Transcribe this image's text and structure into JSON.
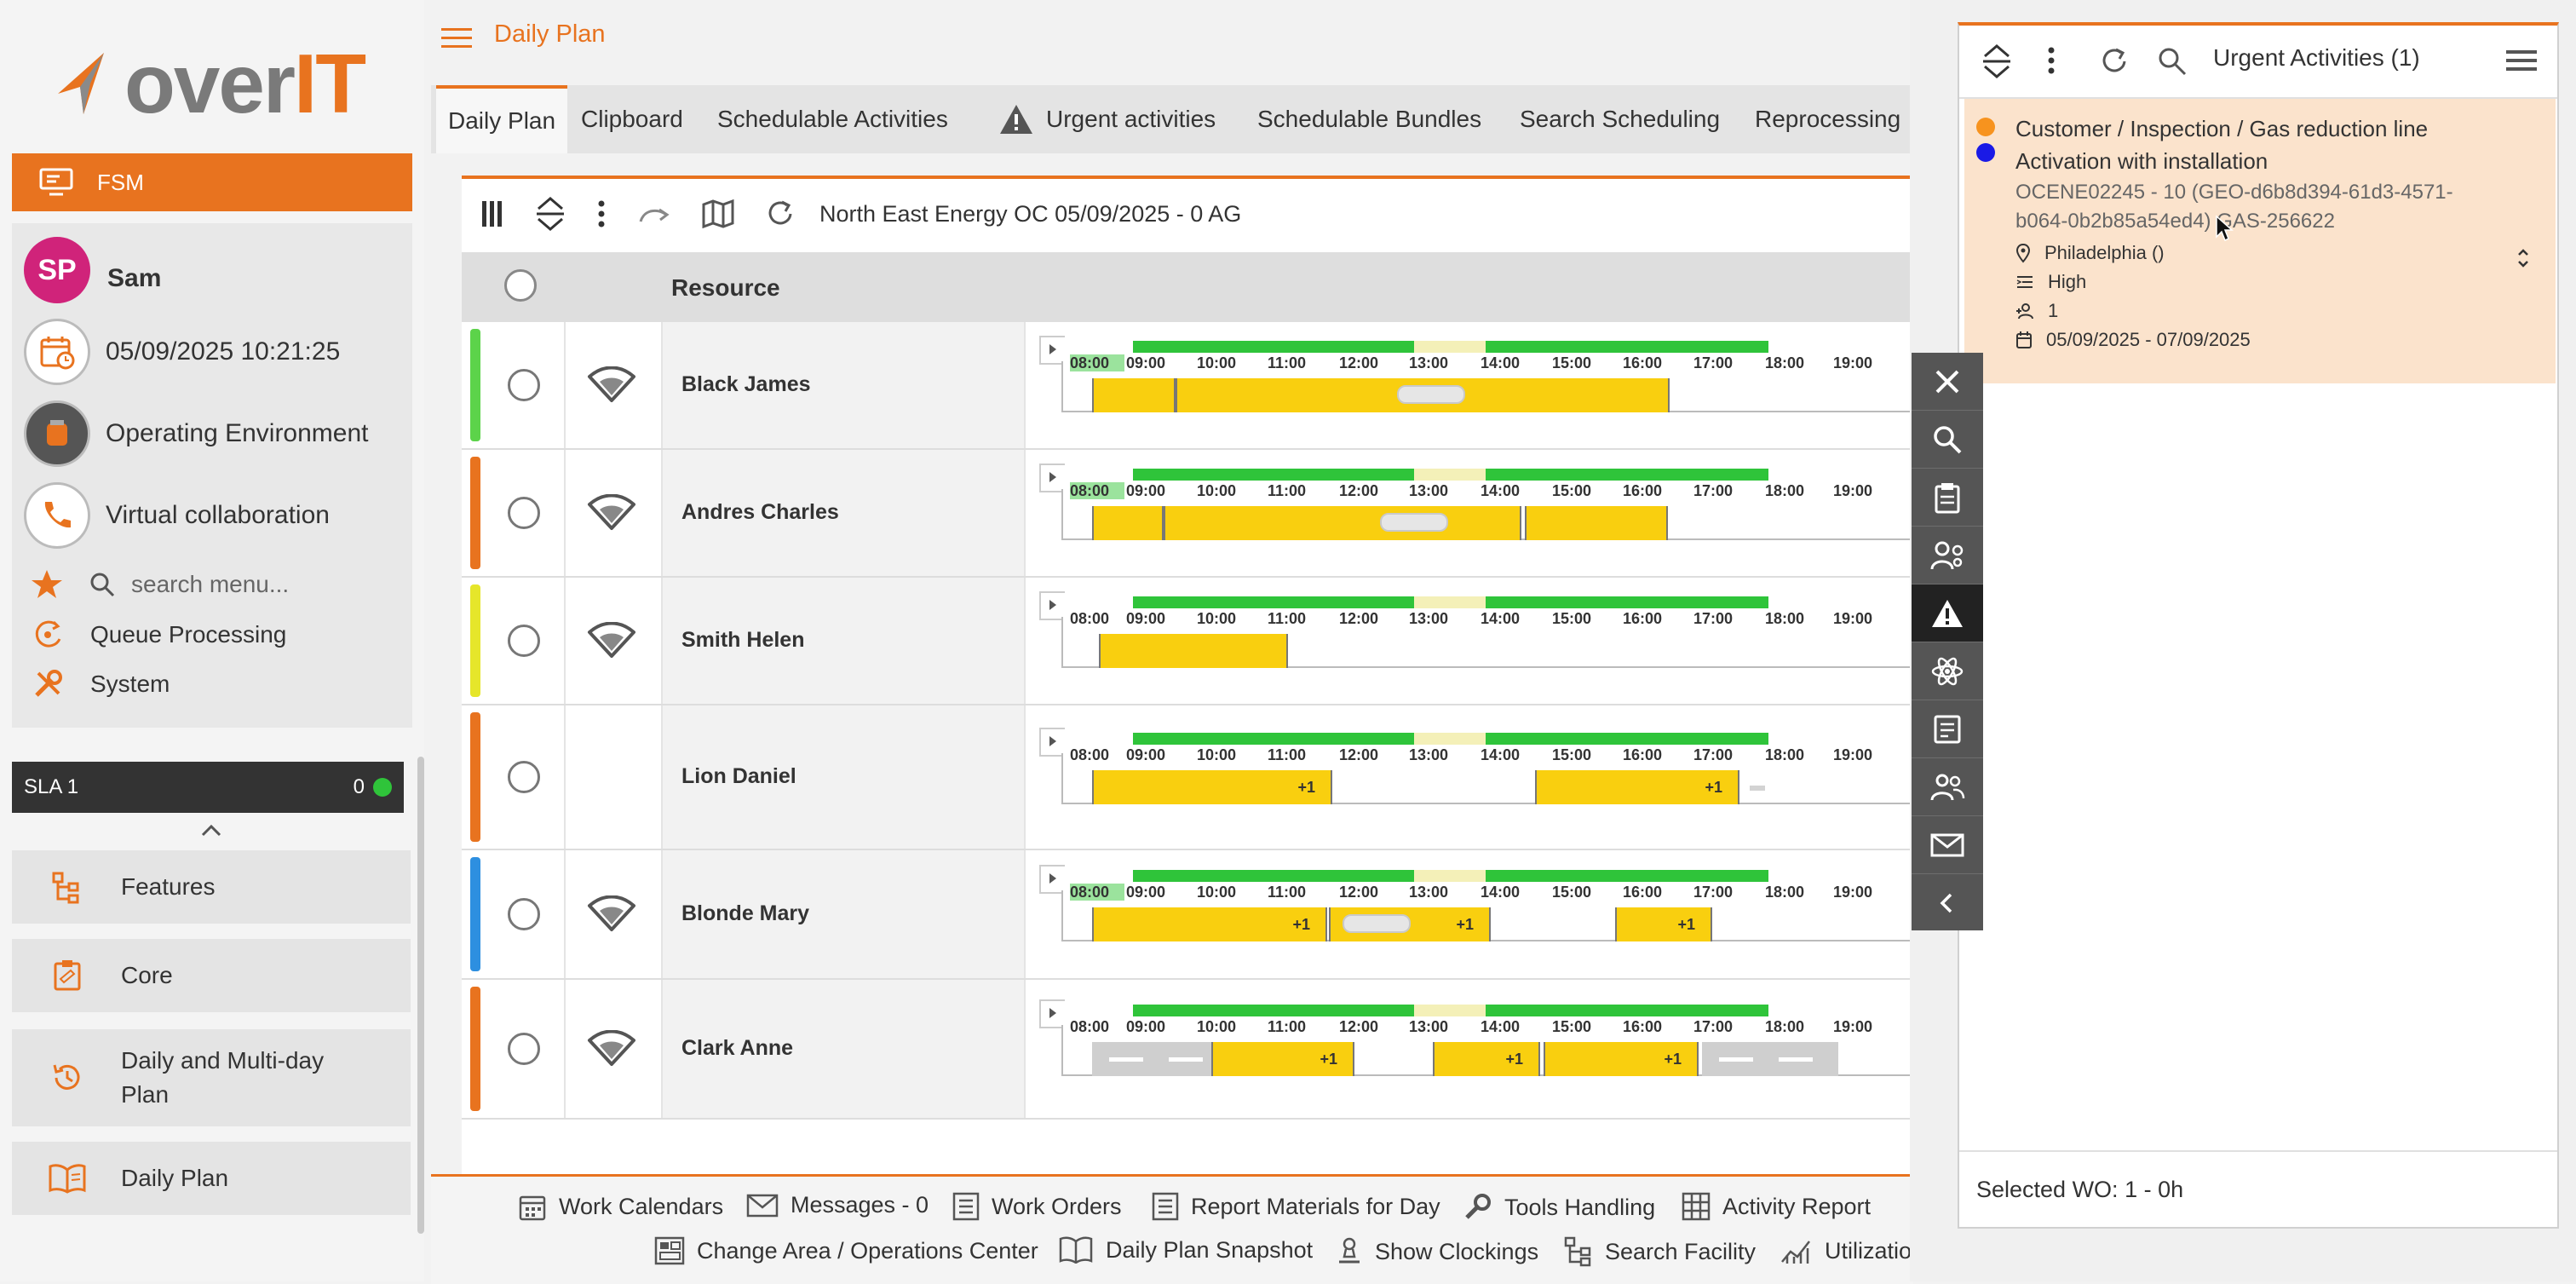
{
  "app": {
    "logo_text_a": "over",
    "logo_text_b": "IT",
    "module_label": "FSM",
    "page_title": "Daily Plan",
    "brand_color": "#e8731f"
  },
  "user_panel": {
    "avatar_initials": "SP",
    "user_name": "Sam",
    "datetime": "05/09/2025 10:21:25",
    "operating_env": "Operating Environment",
    "virtual_collab": "Virtual collaboration",
    "search_placeholder": "search menu...",
    "queue": "Queue Processing",
    "system": "System"
  },
  "sla": {
    "label": "SLA 1",
    "count": "0",
    "status_color": "#2fc43a"
  },
  "menu_tiles": [
    {
      "label": "Features",
      "icon": "features-icon"
    },
    {
      "label": "Core",
      "icon": "core-icon"
    },
    {
      "label": "Daily and Multi-day Plan",
      "label_line1": "Daily and Multi-day",
      "label_line2": "Plan",
      "icon": "history-icon"
    },
    {
      "label": "Daily Plan",
      "icon": "book-icon"
    }
  ],
  "tabs": [
    {
      "label": "Daily Plan",
      "active": true
    },
    {
      "label": "Clipboard"
    },
    {
      "label": "Schedulable Activities"
    },
    {
      "label": "Urgent activities",
      "icon": "warning-icon"
    },
    {
      "label": "Schedulable Bundles"
    },
    {
      "label": "Search Scheduling"
    },
    {
      "label": "Reprocessing"
    }
  ],
  "grid": {
    "toolbar_label": "North East Energy OC 05/09/2025 - 0 AG",
    "header_resource": "Resource",
    "hours": [
      "08:00",
      "09:00",
      "10:00",
      "11:00",
      "12:00",
      "13:00",
      "14:00",
      "15:00",
      "16:00",
      "17:00",
      "18:00",
      "19:00"
    ],
    "rows": [
      {
        "name": "Black James",
        "stripe": "#5cd34a",
        "wifi": true
      },
      {
        "name": "Andres Charles",
        "stripe": "#e8731f",
        "wifi": true
      },
      {
        "name": "Smith Helen",
        "stripe": "#e6e62a",
        "wifi": true
      },
      {
        "name": "Lion Daniel",
        "stripe": "#e8731f",
        "wifi": false,
        "badges": [
          "+1",
          "+1"
        ]
      },
      {
        "name": "Blonde Mary",
        "stripe": "#2d8fe0",
        "wifi": true,
        "badges": [
          "+1",
          "+1",
          "+1"
        ]
      },
      {
        "name": "Clark Anne",
        "stripe": "#e8731f",
        "wifi": true,
        "badges": [
          "+1",
          "+1",
          "+1"
        ]
      }
    ]
  },
  "bottom_toolbar": {
    "row1": [
      "Work Calendars",
      "Messages - 0",
      "Work Orders",
      "Report Materials for Day",
      "Tools Handling",
      "Activity Report"
    ],
    "row2": [
      "Change Area / Operations Center",
      "Daily Plan Snapshot",
      "Show Clockings",
      "Search Facility",
      "Utilization"
    ]
  },
  "urgent_panel": {
    "title": "Urgent Activities (1)",
    "card": {
      "line1": "Customer / Inspection / Gas reduction line",
      "line2": "Activation with installation",
      "code1": "OCENE02245 - 10 (GEO-d6b8d394-61d3-4571-",
      "code2": "b064-0b2b85a54ed4) GAS-256622",
      "location": "Philadelphia ()",
      "priority": "High",
      "people": "1",
      "dates": "05/09/2025 - 07/09/2025",
      "dot_colors": [
        "#f7931e",
        "#1a1ae6"
      ]
    },
    "footer": "Selected WO: 1 - 0h"
  }
}
